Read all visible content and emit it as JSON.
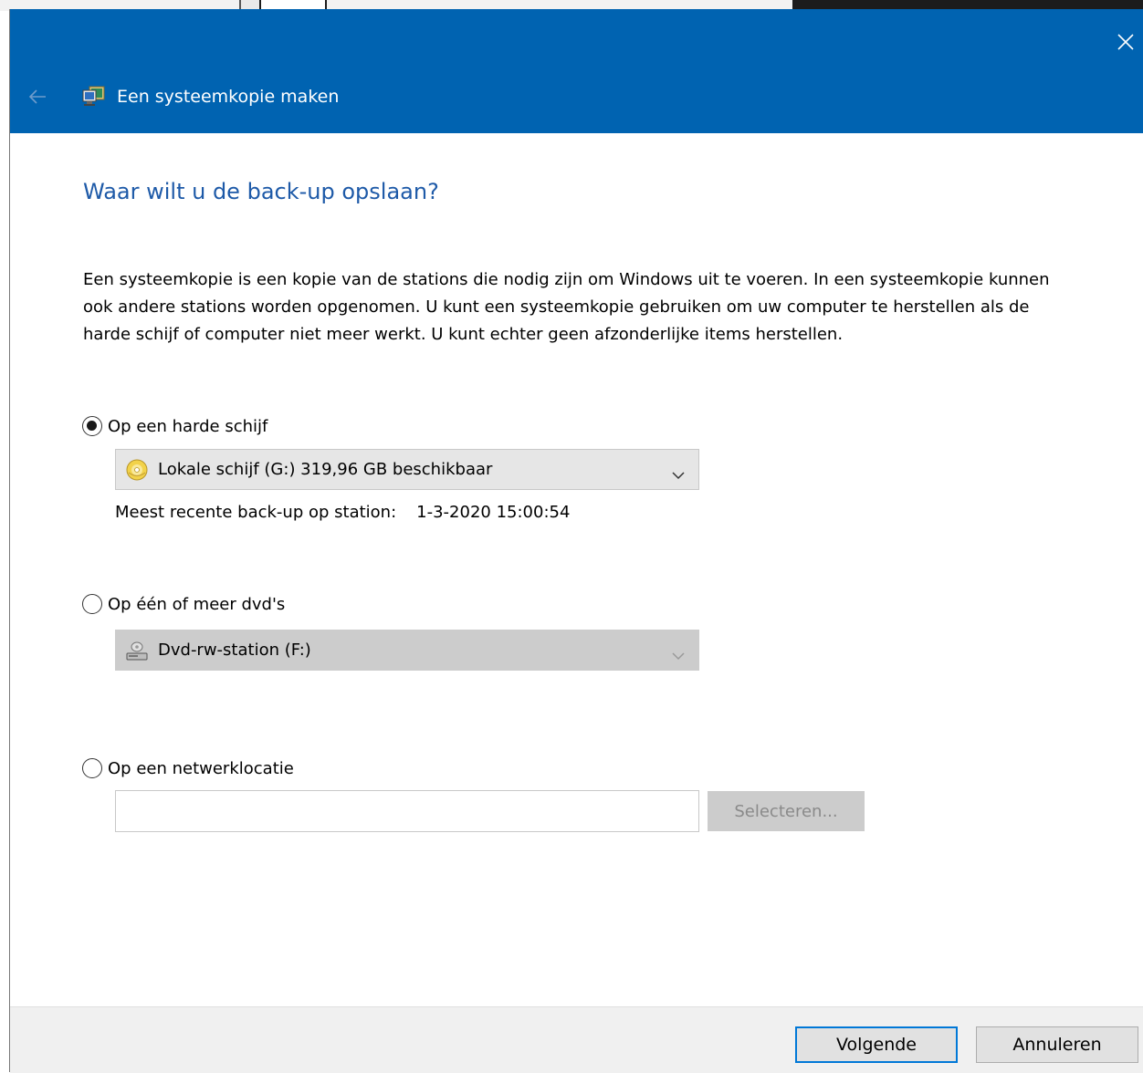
{
  "window": {
    "title": "Een systeemkopie maken",
    "icons": {
      "back": "back-arrow-icon",
      "app": "backup-computer-icon",
      "close": "close-icon"
    },
    "colors": {
      "titlebar": "#0063b1",
      "heading": "#1e5aa8",
      "primary_border": "#0078d7"
    }
  },
  "main": {
    "heading": "Waar wilt u de back-up opslaan?",
    "description": "Een systeemkopie is een kopie van de stations die nodig zijn om Windows uit te voeren. In een systeemkopie kunnen ook andere stations worden opgenomen. U kunt een systeemkopie gebruiken om uw computer te herstellen als de harde schijf of computer niet meer werkt. U kunt echter geen afzonderlijke items herstellen.",
    "options": [
      {
        "label": "Op een harde schijf",
        "selected": true,
        "dropdown": {
          "value": "Lokale schijf (G:)  319,96 GB beschikbaar",
          "icon": "disk-drive-icon",
          "enabled": true
        },
        "recent_label": "Meest recente back-up op station:",
        "recent_value": "1-3-2020 15:00:54"
      },
      {
        "label": "Op één of meer dvd's",
        "selected": false,
        "dropdown": {
          "value": "Dvd-rw-station (F:)",
          "icon": "dvd-drive-icon",
          "enabled": false
        }
      },
      {
        "label": "Op een netwerklocatie",
        "selected": false,
        "input_value": "",
        "select_button": "Selecteren..."
      }
    ]
  },
  "footer": {
    "next": "Volgende",
    "cancel": "Annuleren"
  }
}
